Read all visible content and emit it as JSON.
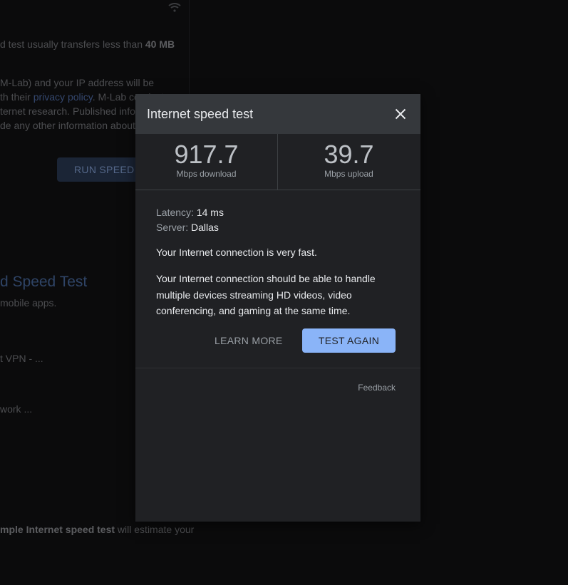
{
  "background": {
    "lines": [
      {
        "pre": "",
        "text": "d test usually transfers less than ",
        "bold": "40 MB",
        "post": ""
      },
      {
        "text": "M-Lab) and your IP address will be"
      },
      {
        "pre": "th their ",
        "link": "privacy policy",
        "post": ". M-Lab conduct"
      },
      {
        "text": "ternet research. Published infor"
      },
      {
        "text": "de any other information about"
      },
      {
        "text": "mobile apps."
      },
      {
        "text": "t VPN - ..."
      },
      {
        "text": "work ..."
      },
      {
        "bold": "mple Internet speed test",
        "post": " will estimate your"
      }
    ],
    "run_button_label": "RUN SPEED",
    "heading": "d Speed Test"
  },
  "dialog": {
    "title": "Internet speed test",
    "download": {
      "value": "917.7",
      "unit": "Mbps download"
    },
    "upload": {
      "value": "39.7",
      "unit": "Mbps upload"
    },
    "latency_label": "Latency:",
    "latency_value": "14 ms",
    "server_label": "Server:",
    "server_value": "Dallas",
    "message_short": "Your Internet connection is very fast.",
    "message_long": "Your Internet connection should be able to handle multiple devices streaming HD videos, video conferencing, and gaming at the same time.",
    "learn_more_label": "LEARN MORE",
    "test_again_label": "TEST AGAIN",
    "feedback_label": "Feedback"
  },
  "colors": {
    "accent": "#8ab4f8",
    "dialog_bg": "#202124",
    "header_bg": "#35383c"
  },
  "icons": {
    "close": "close-icon",
    "wifi": "wifi-icon"
  }
}
